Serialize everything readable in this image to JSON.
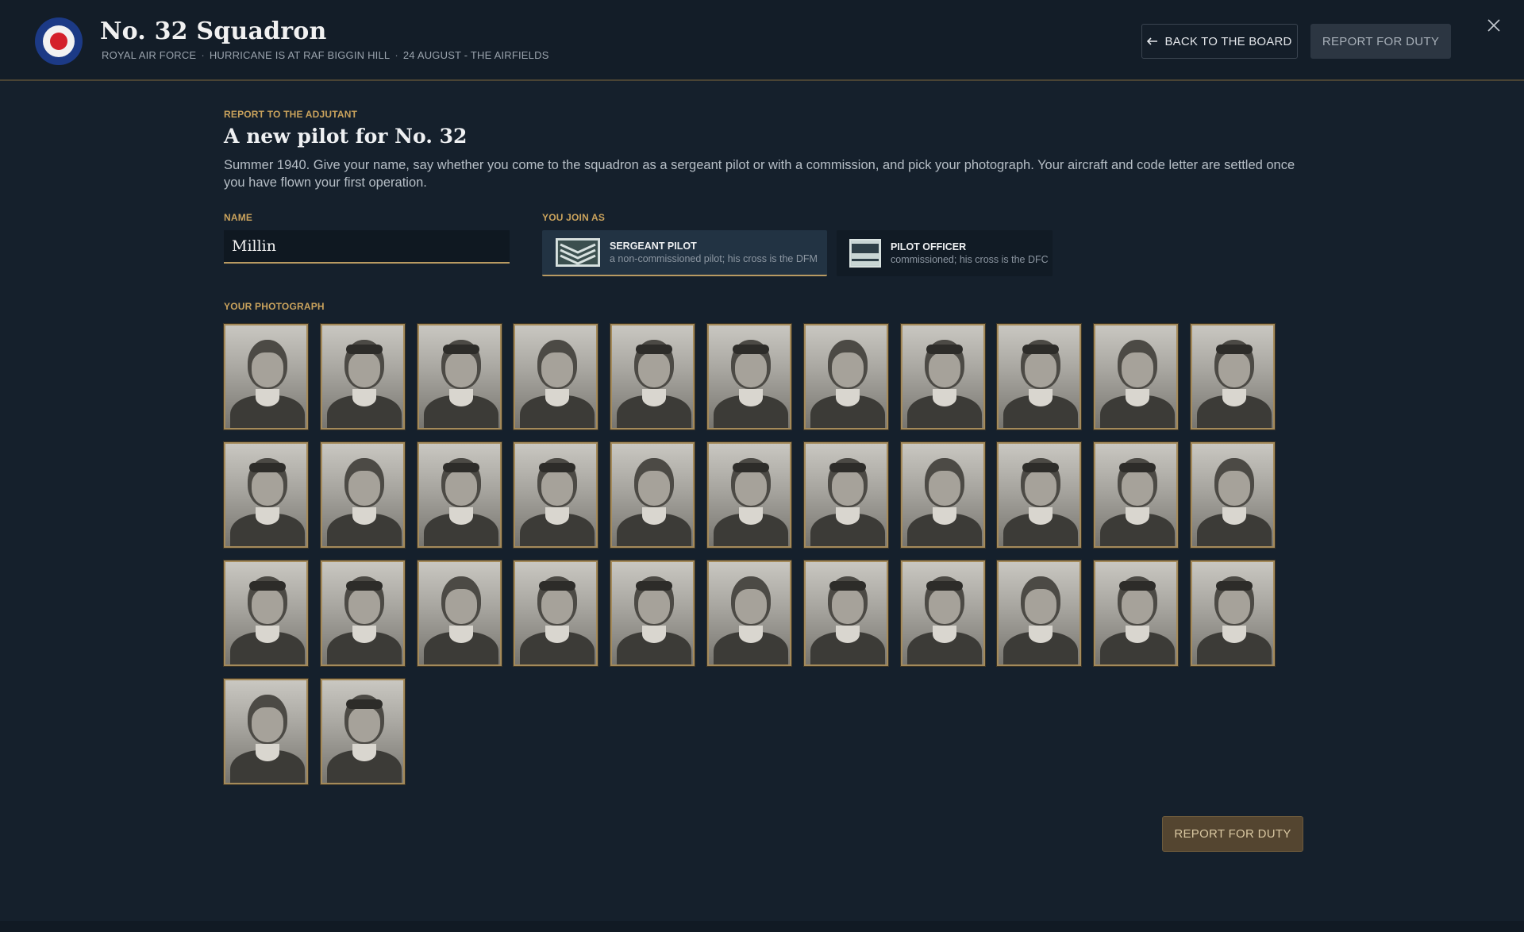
{
  "header": {
    "title": "No. 32 Squadron",
    "subtitle_parts": [
      "ROYAL AIR FORCE",
      "HURRICANE IS AT RAF BIGGIN HILL",
      "24 AUGUST - THE AIRFIELDS"
    ],
    "separator": "·",
    "back_label": "BACK TO THE BOARD",
    "report_label": "REPORT FOR DUTY",
    "roundel_colors": {
      "outer": "#1c3a86",
      "middle": "#f2f2f2",
      "inner": "#d4202a"
    }
  },
  "main": {
    "eyebrow": "REPORT TO THE ADJUTANT",
    "title": "A new pilot for No. 32",
    "intro": "Summer 1940. Give your name, say whether you come to the squadron as a sergeant pilot or with a commission, and pick your photograph. Your aircraft and code letter are settled once you have flown your first operation.",
    "name_label": "NAME",
    "name_value": "Millin",
    "join_label": "YOU JOIN AS",
    "ranks": [
      {
        "name": "SERGEANT PILOT",
        "desc": "a non-commissioned pilot; his cross is the DFM",
        "selected": true
      },
      {
        "name": "PILOT OFFICER",
        "desc": "commissioned; his cross is the DFC",
        "selected": false
      }
    ],
    "photo_label": "YOUR PHOTOGRAPH",
    "photo_count": 35,
    "report_label": "REPORT FOR DUTY"
  },
  "colors": {
    "accent_gold": "#c9a25c",
    "background": "#15202c"
  }
}
